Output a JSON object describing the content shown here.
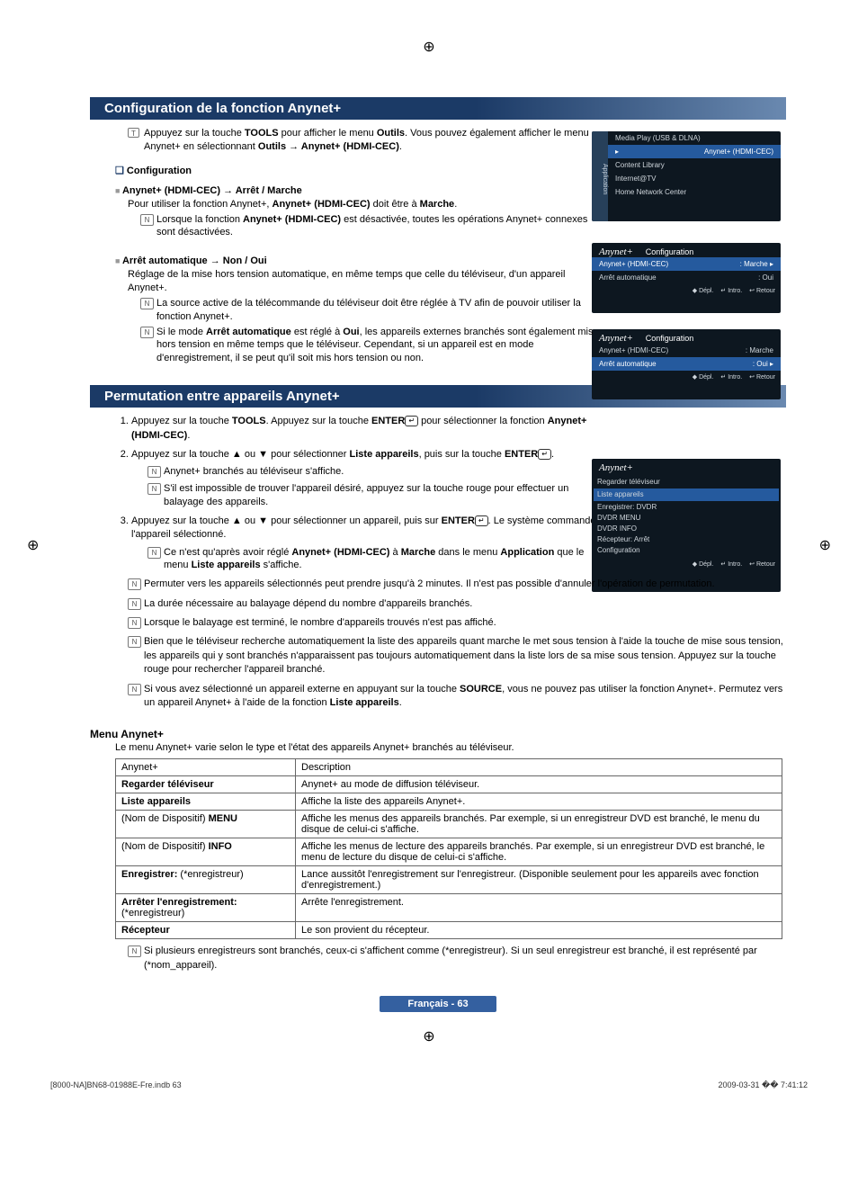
{
  "section1": {
    "title": "Configuration de la fonction Anynet+",
    "tool_line_part1": "Appuyez sur la touche ",
    "tool_bold1": "TOOLS",
    "tool_line_part2": " pour afficher le menu ",
    "tool_bold2": "Outils",
    "tool_line_part3": ". Vous pouvez également afficher le menu Anynet+ en sélectionnant ",
    "tool_bold3": "Outils → Anynet+ (HDMI-CEC)",
    "config_heading": "Configuration",
    "hdmi_heading": "Anynet+ (HDMI-CEC) → Arrêt / Marche",
    "hdmi_body_1": "Pour utiliser la fonction Anynet+, ",
    "hdmi_body_bold": "Anynet+ (HDMI-CEC)",
    "hdmi_body_2": " doit être à ",
    "hdmi_body_bold2": "Marche",
    "hdmi_note_1a": "Lorsque la fonction ",
    "hdmi_note_1b": "Anynet+ (HDMI-CEC)",
    "hdmi_note_1c": " est désactivée, toutes les opérations Anynet+ connexes sont désactivées.",
    "arret_heading": "Arrêt automatique → Non / Oui",
    "arret_body": "Réglage de la mise hors tension automatique, en même temps que celle du téléviseur, d'un appareil Anynet+.",
    "arret_note1": "La source active de la télécommande du téléviseur doit être réglée à TV afin de pouvoir utiliser la fonction Anynet+.",
    "arret_note2_a": "Si le mode ",
    "arret_note2_bold": "Arrêt automatique",
    "arret_note2_b": " est réglé à ",
    "arret_note2_bold2": "Oui",
    "arret_note2_c": ", les appareils externes branchés sont également mis hors tension en même temps que le téléviseur. Cependant, si un appareil est en mode d'enregistrement, il se peut qu'il soit mis hors tension ou non."
  },
  "section2": {
    "title": "Permutation entre appareils Anynet+",
    "step1_a": "Appuyez sur la touche ",
    "step1_b": "TOOLS",
    "step1_c": ". Appuyez sur la touche ",
    "step1_d": "ENTER",
    "step1_e": " pour sélectionner la fonction ",
    "step1_f": "Anynet+ (HDMI-CEC)",
    "step2_a": "Appuyez sur la touche ▲ ou ▼ pour sélectionner ",
    "step2_b": "Liste appareils",
    "step2_c": ", puis sur la touche ",
    "step2_d": "ENTER",
    "step2_note1": "Anynet+ branchés au téléviseur s'affiche.",
    "step2_note2": "S'il est impossible de trouver l'appareil désiré, appuyez sur la touche rouge pour effectuer un balayage des appareils.",
    "step3_a": "Appuyez sur la touche ▲ ou ▼ pour sélectionner un appareil, puis sur ",
    "step3_b": "ENTER",
    "step3_c": ". Le système commande l'appareil sélectionné.",
    "step3_note_a": "Ce n'est qu'après avoir réglé ",
    "step3_note_b": "Anynet+ (HDMI-CEC)",
    "step3_note_c": " à ",
    "step3_note_d": "Marche",
    "step3_note_e": " dans le menu ",
    "step3_note_f": "Application",
    "step3_note_g": " que le menu ",
    "step3_note_h": "Liste appareils",
    "step3_note_i": " s'affiche.",
    "bottom_notes": [
      "Permuter vers les appareils sélectionnés peut prendre jusqu'à 2 minutes. Il n'est pas possible d'annuler l'opération de permutation.",
      "La durée nécessaire au balayage dépend du nombre d'appareils branchés.",
      "Lorsque le balayage est terminé, le nombre d'appareils trouvés n'est pas affiché.",
      "Bien que le téléviseur recherche automatiquement la liste des appareils quant marche le met sous tension à l'aide la touche de mise sous tension, les appareils qui y sont branchés n'apparaissent pas toujours automatiquement dans la liste lors de sa mise sous tension. Appuyez sur la touche rouge pour rechercher l'appareil branché."
    ],
    "bottom_note_last_a": "Si vous avez sélectionné un appareil externe en appuyant sur la touche ",
    "bottom_note_last_b": "SOURCE",
    "bottom_note_last_c": ", vous ne pouvez pas utiliser la fonction Anynet+. Permutez vers un appareil Anynet+ à l'aide de la fonction ",
    "bottom_note_last_d": "Liste appareils"
  },
  "menu": {
    "heading": "Menu Anynet+",
    "intro": "Le menu Anynet+ varie selon le type et l'état des appareils Anynet+ branchés au téléviseur.",
    "col1": "Anynet+",
    "col2": "Description",
    "rows": [
      {
        "c1_bold": "Regarder téléviseur",
        "c2": "Anynet+ au mode de diffusion téléviseur."
      },
      {
        "c1_bold": "Liste appareils",
        "c2": "Affiche la liste des appareils Anynet+."
      },
      {
        "c1_prefix": "(Nom de Dispositif) ",
        "c1_bold": "MENU",
        "c2": "Affiche les menus des appareils branchés. Par exemple, si un enregistreur DVD est branché, le menu du disque de celui-ci s'affiche."
      },
      {
        "c1_prefix": "(Nom de Dispositif) ",
        "c1_bold": "INFO",
        "c2": "Affiche les menus de lecture des appareils branchés. Par exemple, si un enregistreur DVD est branché, le menu de lecture du disque de celui-ci s'affiche."
      },
      {
        "c1_bold": "Enregistrer:",
        "c1_suffix": " (*enregistreur)",
        "c2": "Lance aussitôt l'enregistrement sur l'enregistreur. (Disponible seulement pour les appareils avec fonction d'enregistrement.)"
      },
      {
        "c1_bold": "Arrêter l'enregistrement:",
        "c1_suffix2": "(*enregistreur)",
        "c2": "Arrête l'enregistrement."
      },
      {
        "c1_bold": "Récepteur",
        "c2": "Le son provient du récepteur."
      }
    ],
    "table_note": "Si plusieurs enregistreurs sont branchés, ceux-ci s'affichent comme (*enregistreur). Si un seul enregistreur est branché, il est représenté par (*nom_appareil)."
  },
  "osd1": {
    "items": [
      "Media Play (USB & DLNA)",
      "Anynet+ (HDMI-CEC)",
      "Content Library",
      "Internet@TV",
      "Home Network Center"
    ],
    "sidelabel": "Application"
  },
  "osd2": {
    "brand": "Anynet+",
    "title": "Configuration",
    "row1_l": "Anynet+ (HDMI-CEC)",
    "row1_r": ": Marche",
    "row2_l": "Arrêt automatique",
    "row2_r": ": Oui",
    "footer": [
      "◆ Dépl.",
      "↵ Intro.",
      "↩ Retour"
    ]
  },
  "osd4": {
    "brand": "Anynet+",
    "items": [
      "Regarder téléviseur",
      "Liste appareils",
      "Enregistrer: DVDR",
      "DVDR MENU",
      "DVDR INFO",
      "Récepteur: Arrêt",
      "Configuration"
    ],
    "footer": [
      "◆ Dépl.",
      "↵ Intro.",
      "↩ Retour"
    ]
  },
  "page_label": "Français - 63",
  "footer_left": "[8000-NA]BN68-01988E-Fre.indb   63",
  "footer_right": "2009-03-31   �� 7:41:12"
}
